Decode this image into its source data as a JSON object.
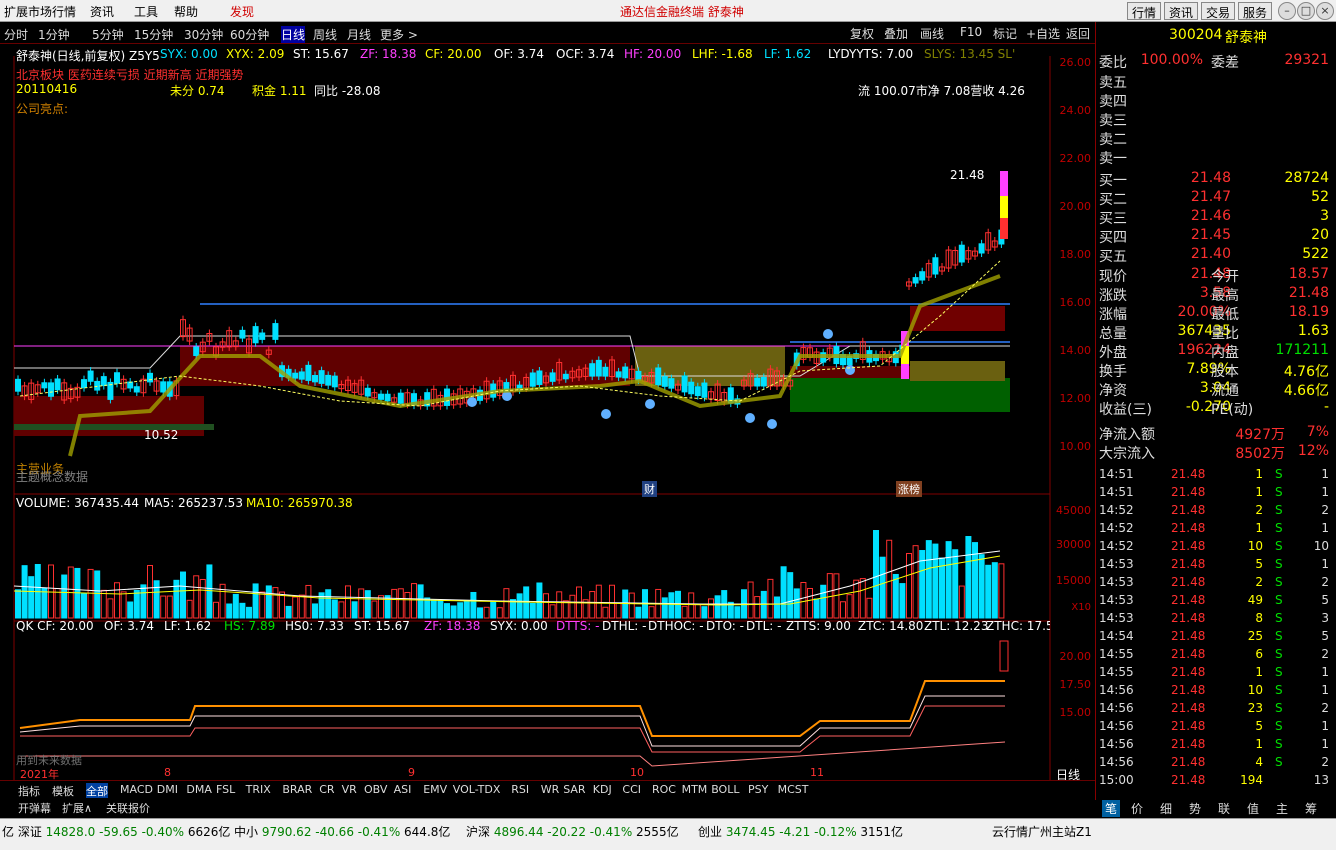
{
  "menubar": {
    "items": [
      "扩展市场行情",
      "资讯",
      "工具",
      "帮助",
      "发现"
    ],
    "title": "通达信金融终端  舒泰神",
    "buttons": [
      "行情",
      "资讯",
      "交易",
      "服务"
    ]
  },
  "periods": [
    "分时",
    "1分钟",
    "5分钟",
    "15分钟",
    "30分钟",
    "60分钟",
    "日线",
    "周线",
    "月线",
    "更多 >"
  ],
  "tools": [
    "复权",
    "叠加",
    "画线",
    "F10",
    "标记",
    "+自选",
    "返回"
  ],
  "info": {
    "name": "舒泰神(日线,前复权) Z5Y5",
    "syx": "SYX: 0.00",
    "xyx": "XYX: 2.09",
    "st": "ST: 15.67",
    "zf": "ZF: 18.38",
    "cf": "CF: 20.00",
    "of": "OF: 3.74",
    "ocf": "OCF: 3.74",
    "hf": "HF: 20.00",
    "lhf": "LHF: -1.68",
    "lf": "LF: 1.62",
    "lyd": "LYDYYTS: 7.00",
    "sly": "SLYS: 13.45 SL'",
    "line2": "北京板块  医药连续亏损  近期新高  近期强势",
    "date": "20110416",
    "weifen": "未分 0.74",
    "jijin": "积金 1.11",
    "tongbi": "同比 -28.08",
    "liu": "流 100.07市净 7.08营收 4.26",
    "liangdian": "公司亮点:"
  },
  "main": {
    "max_label": "21.48",
    "min_label": "10.52",
    "caibadge": "财",
    "zhangbang": "涨榜",
    "zhuying": "主营业务",
    "tisi": "主题概念数据"
  },
  "axis1": [
    "26.00",
    "24.00",
    "22.00",
    "20.00",
    "18.00",
    "16.00",
    "14.00",
    "12.00",
    "10.00"
  ],
  "volume": {
    "vol": "VOLUME: 367435.44",
    "ma5": "MA5: 265237.53",
    "ma10": "MA10: 265970.38",
    "ticks": [
      "45000",
      "30000",
      "15000"
    ],
    "x10": "X10"
  },
  "ind": {
    "qk": "QK CF: 20.00",
    "of": "OF: 3.74",
    "lf": "LF: 1.62",
    "hs": "HS: 7.89",
    "hs0": "HS0: 7.33",
    "st": "ST: 15.67",
    "zf": "ZF: 18.38",
    "syx": "SYX: 0.00",
    "dtts": "DTTS: -",
    "dthl": "DTHL: -",
    "dthoc": "DTHOC: -",
    "dto": "DTO: -",
    "dtl": "DTL: -",
    "ztts": "ZTTS: 9.00",
    "ztc": "ZTC: 14.80",
    "ztl": "ZTL: 12.23",
    "zthc": "ZTHC: 17.5",
    "ticks": [
      "20.00",
      "17.50",
      "15.00"
    ],
    "nodata": "用到未来数据"
  },
  "xaxis": [
    "2021年",
    "8",
    "9",
    "10",
    "11"
  ],
  "kline_label": "日线",
  "tabs": [
    "指标",
    "模板",
    "全部",
    "MACD",
    "DMI",
    "DMA",
    "FSL",
    "TRIX",
    "BRAR",
    "CR",
    "VR",
    "OBV",
    "ASI",
    "EMV",
    "VOL-TDX",
    "RSI",
    "WR",
    "SAR",
    "KDJ",
    "CCI",
    "ROC",
    "MTM",
    "BOLL",
    "PSY",
    "MCST"
  ],
  "subtabs": [
    "开弹幕",
    "扩展∧",
    "关联报价"
  ],
  "right": {
    "code": "300204",
    "name": "舒泰神",
    "weibi": "委比",
    "weibi_v": "100.00%",
    "weicha": "委差",
    "weicha_v": "29321",
    "sells": [
      "卖五",
      "卖四",
      "卖三",
      "卖二",
      "卖一"
    ],
    "buys": [
      {
        "l": "买一",
        "p": "21.48",
        "v": "28724"
      },
      {
        "l": "买二",
        "p": "21.47",
        "v": "52"
      },
      {
        "l": "买三",
        "p": "21.46",
        "v": "3"
      },
      {
        "l": "买四",
        "p": "21.45",
        "v": "20"
      },
      {
        "l": "买五",
        "p": "21.40",
        "v": "522"
      }
    ],
    "stats": [
      [
        "现价",
        "21.48",
        "今开",
        "18.57"
      ],
      [
        "涨跌",
        "3.58",
        "最高",
        "21.48"
      ],
      [
        "涨幅",
        "20.00%",
        "最低",
        "18.19"
      ],
      [
        "总量",
        "367435",
        "量比",
        "1.63"
      ],
      [
        "外盘",
        "196224",
        "内盘",
        "171211"
      ],
      [
        "换手",
        "7.89%",
        "股本",
        "4.76亿"
      ],
      [
        "净资",
        "3.04",
        "流通",
        "4.66亿"
      ],
      [
        "收益(三)",
        "-0.270",
        "PE(动)",
        "-"
      ]
    ],
    "flow1": [
      "净流入额",
      "4927万",
      "7%"
    ],
    "flow2": [
      "大宗流入",
      "8502万",
      "12%"
    ],
    "trades": [
      [
        "14:51",
        "21.48",
        "1",
        "S",
        "1"
      ],
      [
        "14:51",
        "21.48",
        "1",
        "S",
        "1"
      ],
      [
        "14:52",
        "21.48",
        "2",
        "S",
        "2"
      ],
      [
        "14:52",
        "21.48",
        "1",
        "S",
        "1"
      ],
      [
        "14:52",
        "21.48",
        "10",
        "S",
        "10"
      ],
      [
        "14:53",
        "21.48",
        "5",
        "S",
        "1"
      ],
      [
        "14:53",
        "21.48",
        "2",
        "S",
        "2"
      ],
      [
        "14:53",
        "21.48",
        "49",
        "S",
        "5"
      ],
      [
        "14:53",
        "21.48",
        "8",
        "S",
        "3"
      ],
      [
        "14:54",
        "21.48",
        "25",
        "S",
        "5"
      ],
      [
        "14:55",
        "21.48",
        "6",
        "S",
        "2"
      ],
      [
        "14:55",
        "21.48",
        "1",
        "S",
        "1"
      ],
      [
        "14:56",
        "21.48",
        "10",
        "S",
        "1"
      ],
      [
        "14:56",
        "21.48",
        "23",
        "S",
        "2"
      ],
      [
        "14:56",
        "21.48",
        "5",
        "S",
        "1"
      ],
      [
        "14:56",
        "21.48",
        "1",
        "S",
        "1"
      ],
      [
        "14:56",
        "21.48",
        "4",
        "S",
        "2"
      ],
      [
        "15:00",
        "21.48",
        "194",
        "",
        "13"
      ]
    ],
    "bottomtabs": [
      "笔",
      "价",
      "细",
      "势",
      "联",
      "值",
      "主",
      "筹"
    ]
  },
  "status": {
    "items": [
      [
        "亿 深证",
        "14828.0",
        "-59.65",
        "-0.40%",
        "6626亿"
      ],
      [
        "中小",
        "9790.62",
        "-40.66",
        "-0.41%",
        "644.8亿"
      ],
      [
        "沪深",
        "4896.44",
        "-20.22",
        "-0.41%",
        "2555亿"
      ],
      [
        "创业",
        "3474.45",
        "-4.21",
        "-0.12%",
        "3151亿"
      ]
    ],
    "server": "云行情广州主站Z1"
  }
}
